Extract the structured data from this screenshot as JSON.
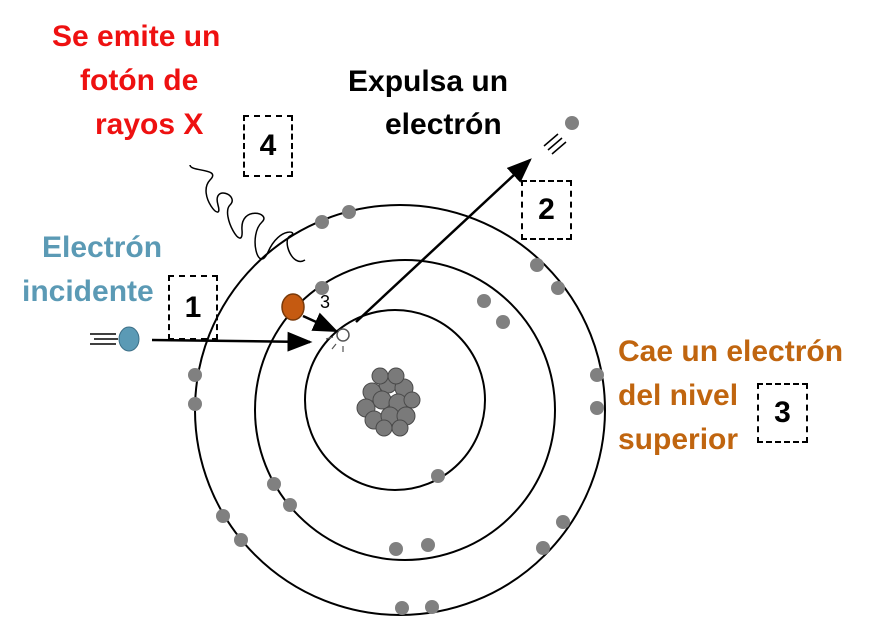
{
  "labels": {
    "xray_line1": "Se emite un",
    "xray_line2": "fotón de",
    "xray_line3": "rayos X",
    "expel_line1": "Expulsa un",
    "expel_line2": "electrón",
    "incident_line1": "Electrón",
    "incident_line2": "incidente",
    "falls_line1": "Cae un electrón",
    "falls_line2": "del nivel",
    "falls_line3": "superior"
  },
  "steps": {
    "s1": "1",
    "s2": "2",
    "s3": "3",
    "s4": "4",
    "arrow_tag": "3"
  },
  "colors": {
    "xray": "#ee1111",
    "expel": "#000000",
    "incident": "#5b9ab5",
    "falls": "#c0650f",
    "electron": "#808080",
    "incident_electron": "#5b9ab5",
    "falling_electron": "#c55a11",
    "nucleus": "#7a7a7a"
  }
}
